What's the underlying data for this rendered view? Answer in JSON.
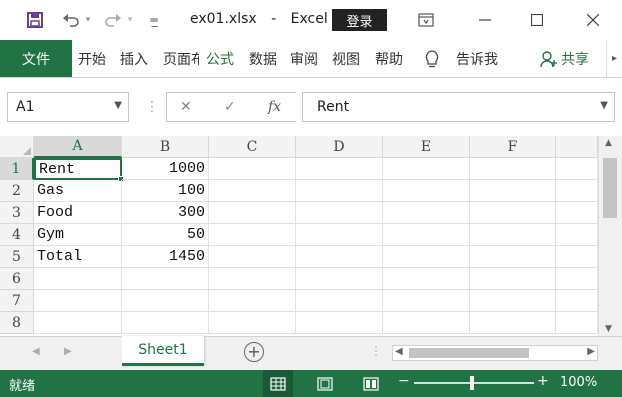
{
  "window": {
    "filename": "ex01.xlsx",
    "app": "Excel",
    "login_label": "登录"
  },
  "ribbon": {
    "file_tab": "文件",
    "tabs": [
      "开始",
      "插入",
      "页面布局",
      "公式",
      "数据",
      "审阅",
      "视图",
      "帮助"
    ],
    "active_tab": "公式",
    "tell_me": "告诉我",
    "share": "共享"
  },
  "formula_bar": {
    "name_box": "A1",
    "fx_label": "fx",
    "value": "Rent"
  },
  "grid": {
    "columns": [
      "A",
      "B",
      "C",
      "D",
      "E",
      "F"
    ],
    "rows": [
      "1",
      "2",
      "3",
      "4",
      "5",
      "6",
      "7",
      "8"
    ],
    "cells": {
      "A1": "Rent",
      "B1": "1000",
      "A2": "Gas",
      "B2": "100",
      "A3": "Food",
      "B3": "300",
      "A4": "Gym",
      "B4": "50",
      "A5": "Total",
      "B5": "1450"
    },
    "active_cell": "A1"
  },
  "sheets": {
    "tabs": [
      "Sheet1"
    ],
    "active": "Sheet1"
  },
  "status_bar": {
    "ready": "就绪",
    "zoom": "100%"
  },
  "colors": {
    "accent": "#217346"
  },
  "icons": {
    "save": "save-icon",
    "undo": "undo-icon",
    "redo": "redo-icon",
    "customize": "customize-quick-access-icon",
    "ribbon_display": "ribbon-display-options-icon",
    "minimize": "minimize-icon",
    "maximize": "maximize-icon",
    "close": "close-icon",
    "lightbulb": "lightbulb-icon",
    "share_person": "share-person-icon",
    "add_sheet": "add-sheet-icon"
  }
}
